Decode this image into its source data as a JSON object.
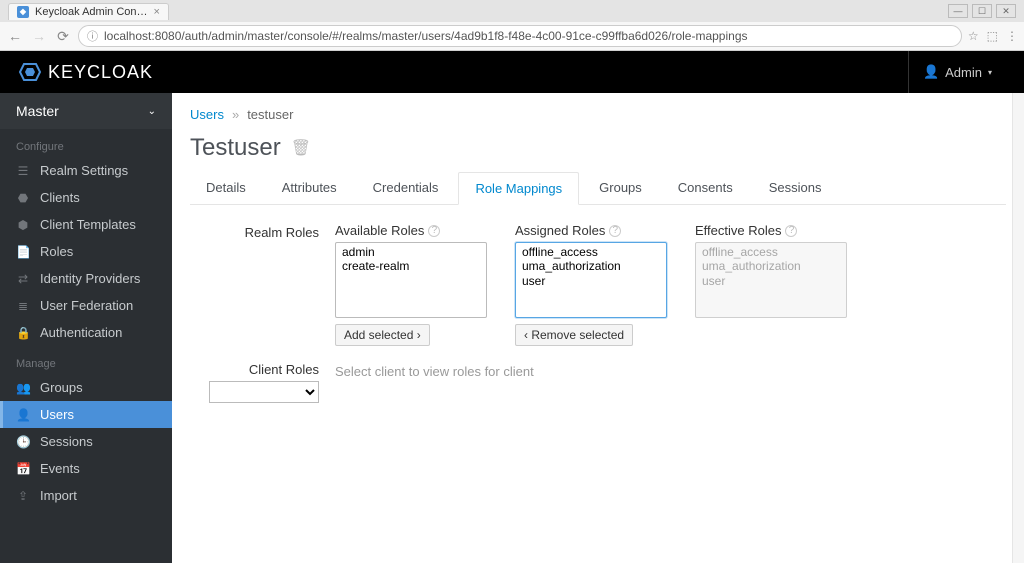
{
  "browser": {
    "tab_title": "Keycloak Admin Con…",
    "url": "localhost:8080/auth/admin/master/console/#/realms/master/users/4ad9b1f8-f48e-4c00-91ce-c99ffba6d026/role-mappings"
  },
  "header": {
    "logo_text": "KEYCLOAK",
    "username": "Admin"
  },
  "sidebar": {
    "realm": "Master",
    "sections": [
      {
        "title": "Configure",
        "items": [
          {
            "label": "Realm Settings",
            "icon": "sliders",
            "id": "realm-settings"
          },
          {
            "label": "Clients",
            "icon": "cube",
            "id": "clients"
          },
          {
            "label": "Client Templates",
            "icon": "cubes",
            "id": "client-templates"
          },
          {
            "label": "Roles",
            "icon": "file",
            "id": "roles"
          },
          {
            "label": "Identity Providers",
            "icon": "exchange",
            "id": "identity-providers"
          },
          {
            "label": "User Federation",
            "icon": "database",
            "id": "user-federation"
          },
          {
            "label": "Authentication",
            "icon": "lock",
            "id": "authentication"
          }
        ]
      },
      {
        "title": "Manage",
        "items": [
          {
            "label": "Groups",
            "icon": "group",
            "id": "groups"
          },
          {
            "label": "Users",
            "icon": "user",
            "id": "users",
            "active": true
          },
          {
            "label": "Sessions",
            "icon": "clock",
            "id": "sessions"
          },
          {
            "label": "Events",
            "icon": "calendar",
            "id": "events"
          },
          {
            "label": "Import",
            "icon": "upload",
            "id": "import"
          }
        ]
      }
    ]
  },
  "breadcrumb": {
    "parent": "Users",
    "current": "testuser"
  },
  "page_title": "Testuser",
  "tabs": [
    {
      "label": "Details",
      "id": "details"
    },
    {
      "label": "Attributes",
      "id": "attributes"
    },
    {
      "label": "Credentials",
      "id": "credentials"
    },
    {
      "label": "Role Mappings",
      "id": "role-mappings",
      "active": true
    },
    {
      "label": "Groups",
      "id": "groups"
    },
    {
      "label": "Consents",
      "id": "consents"
    },
    {
      "label": "Sessions",
      "id": "sessions"
    }
  ],
  "role_mappings": {
    "realm_label": "Realm Roles",
    "client_label": "Client Roles",
    "available_label": "Available Roles",
    "assigned_label": "Assigned Roles",
    "effective_label": "Effective Roles",
    "available": [
      "admin",
      "create-realm"
    ],
    "assigned": [
      "offline_access",
      "uma_authorization",
      "user"
    ],
    "effective": [
      "offline_access",
      "uma_authorization",
      "user"
    ],
    "add_btn": "Add selected ›",
    "remove_btn": "‹ Remove selected",
    "client_hint": "Select client to view roles for client"
  }
}
